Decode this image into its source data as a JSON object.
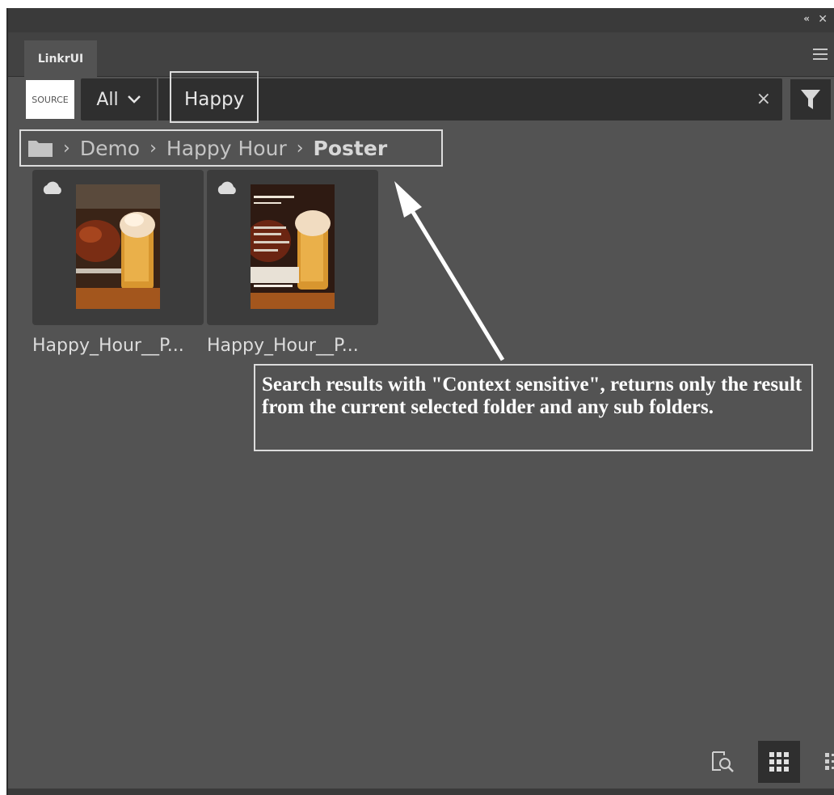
{
  "panel": {
    "tab_label": "LinkrUI"
  },
  "search": {
    "source_label": "SOURCE",
    "scope_label": "All",
    "query": "Happy",
    "clear_glyph": "×"
  },
  "breadcrumb": {
    "items": [
      "Demo",
      "Happy Hour"
    ],
    "current": "Poster",
    "separator": "›"
  },
  "assets": [
    {
      "caption": "Happy_Hour__P...",
      "icon": "cloud-icon"
    },
    {
      "caption": "Happy_Hour__P...",
      "icon": "cloud-icon"
    }
  ],
  "annotation": {
    "text": "Search results with \"Context sensitive\", returns only the result from the current selected folder and any sub folders."
  },
  "toolbar": {
    "icons": [
      "preview-search-icon",
      "grid-view-icon",
      "list-view-icon"
    ],
    "active": "grid-view"
  },
  "colors": {
    "panel_bg": "#535353",
    "field_bg": "#2f2f2f",
    "card_bg": "#3c3c3c",
    "annotation_border": "#dcdcdc"
  }
}
